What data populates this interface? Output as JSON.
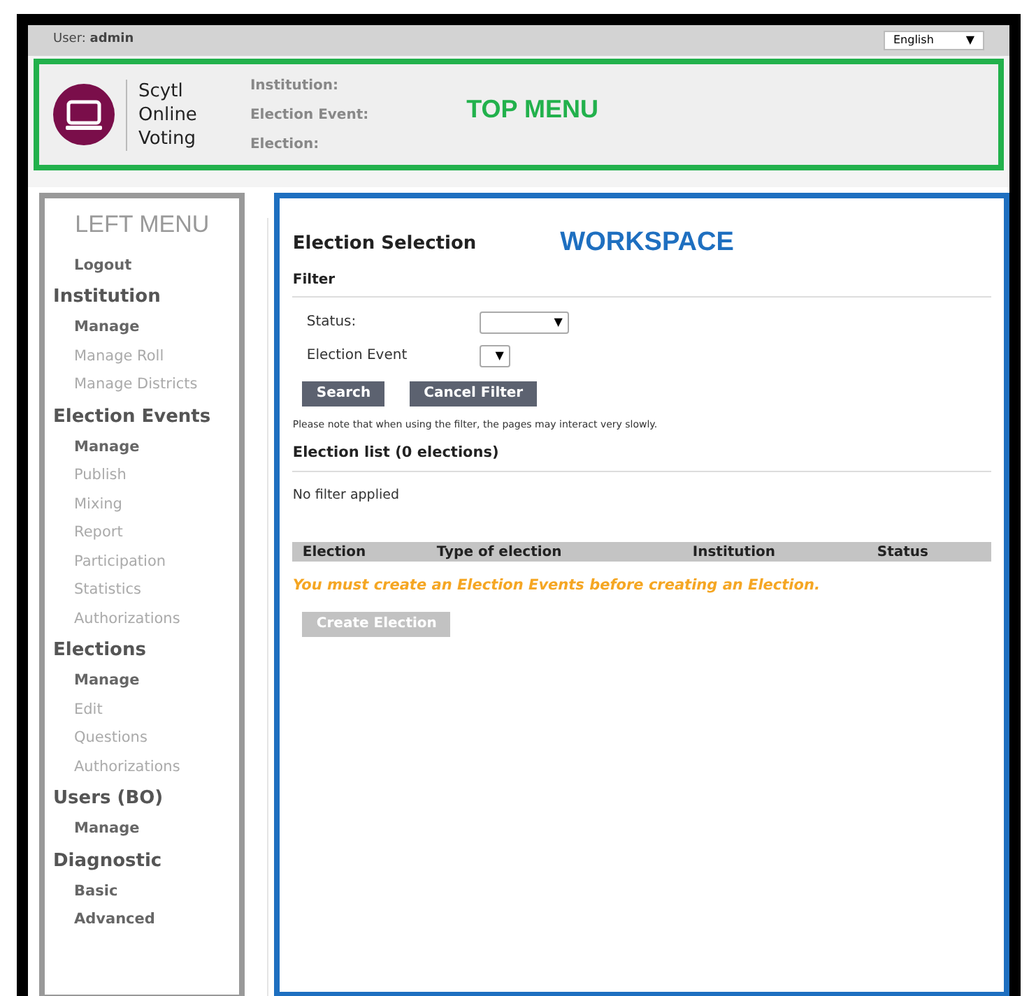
{
  "user_bar": {
    "label": "User:",
    "user": "admin",
    "language": "English",
    "dropdown_arrow": "▼"
  },
  "top_menu": {
    "brand": [
      "Scytl",
      "Online",
      "Voting"
    ],
    "fields": [
      "Institution:",
      "Election Event:",
      "Election:"
    ],
    "annotation": "TOP MENU"
  },
  "left_menu": {
    "annotation": "LEFT MENU",
    "sections": [
      {
        "items": [
          {
            "label": "Logout",
            "disabled": false
          }
        ]
      },
      {
        "title": "Institution",
        "items": [
          {
            "label": "Manage",
            "disabled": false
          },
          {
            "label": "Manage Roll",
            "disabled": true
          },
          {
            "label": "Manage Districts",
            "disabled": true
          }
        ]
      },
      {
        "title": "Election Events",
        "items": [
          {
            "label": "Manage",
            "disabled": false
          },
          {
            "label": "Publish",
            "disabled": true
          },
          {
            "label": "Mixing",
            "disabled": true
          },
          {
            "label": "Report",
            "disabled": true
          },
          {
            "label": "Participation",
            "disabled": true
          },
          {
            "label": "Statistics",
            "disabled": true
          },
          {
            "label": "Authorizations",
            "disabled": true
          }
        ]
      },
      {
        "title": "Elections",
        "items": [
          {
            "label": "Manage",
            "disabled": false
          },
          {
            "label": "Edit",
            "disabled": true
          },
          {
            "label": "Questions",
            "disabled": true
          },
          {
            "label": "Authorizations",
            "disabled": true
          }
        ]
      },
      {
        "title": "Users (BO)",
        "items": [
          {
            "label": "Manage",
            "disabled": false
          }
        ]
      },
      {
        "title": "Diagnostic",
        "items": [
          {
            "label": "Basic",
            "disabled": false
          },
          {
            "label": "Advanced",
            "disabled": false
          }
        ]
      }
    ]
  },
  "workspace": {
    "title": "Election Selection",
    "annotation": "WORKSPACE",
    "filter_heading": "Filter",
    "filters": [
      {
        "label": "Status:"
      },
      {
        "label": "Election Event"
      }
    ],
    "buttons": [
      {
        "label": "Search",
        "disabled": false
      },
      {
        "label": "Cancel Filter",
        "disabled": false
      }
    ],
    "note": "Please note that when using the filter, the pages may interact very slowly.",
    "list_heading": "Election list (0 elections)",
    "filter_status": "No filter applied",
    "table": {
      "columns": [
        "Election",
        "Type of election",
        "Institution",
        "Status"
      ]
    },
    "warning": "You must create an Election Events before creating an Election.",
    "create_button": {
      "label": "Create Election",
      "disabled": true
    }
  }
}
